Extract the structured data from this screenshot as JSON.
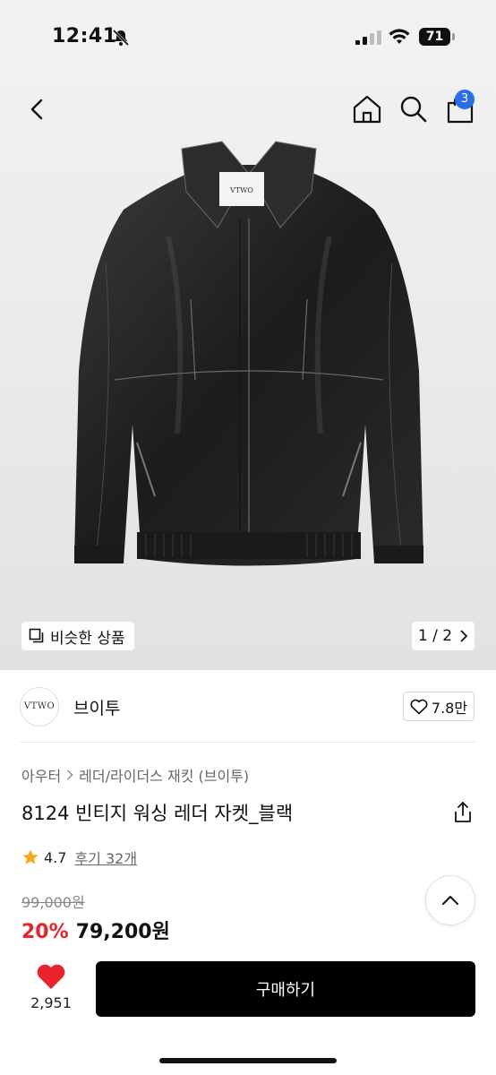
{
  "status_bar": {
    "time": "12:41",
    "battery": "71",
    "icons": [
      "bell-slash-icon",
      "signal-icon",
      "wifi-icon",
      "battery-icon"
    ]
  },
  "header": {
    "icons": [
      "back-chevron-icon",
      "home-icon",
      "search-icon",
      "shopping-bag-icon"
    ],
    "cart_count": "3"
  },
  "gallery": {
    "image": "black leather jacket",
    "label_on_tag": "VTWO",
    "similar_label": "비슷한 상품",
    "page_indicator": "1 / 2"
  },
  "brand": {
    "logo_text": "VTWO",
    "name": "브이투",
    "like_count": "7.8만"
  },
  "product": {
    "breadcrumb": [
      "아우터",
      "레더/라이더스 재킷 (브이투)"
    ],
    "title": "8124 빈티지 워싱 레더 자켓_블랙",
    "rating": "4.7",
    "reviews_label": "후기 32개",
    "original_price": "99,000원",
    "discount": "20%",
    "sale_price": "79,200원"
  },
  "bottom_bar": {
    "wish_count": "2,951",
    "buy_label": "구매하기"
  },
  "colors": {
    "accent_red": "#e8232d",
    "badge_blue": "#2b6de8",
    "star": "#f5a623"
  }
}
